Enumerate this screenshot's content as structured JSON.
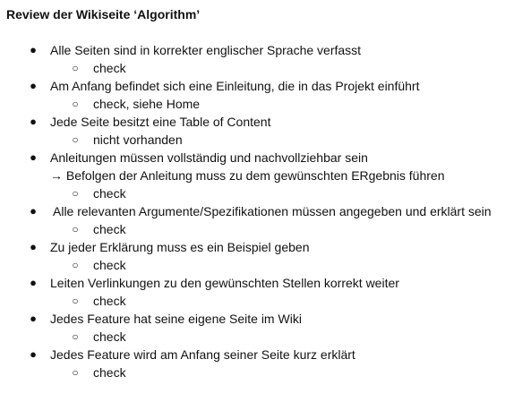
{
  "title": "Review der Wikiseite ‘Algorithm’",
  "bullet_glyph": "●",
  "sub_bullet_glyph": "○",
  "items": [
    {
      "text": "Alle Seiten sind in korrekter englischer Sprache verfasst",
      "sub": "check"
    },
    {
      "text": "Am Anfang befindet sich eine Einleitung, die in das Projekt einführt",
      "sub": "check, siehe Home"
    },
    {
      "text": "Jede Seite besitzt eine Table of Content",
      "sub": "nicht vorhanden"
    },
    {
      "text": "Anleitungen müssen vollständig und nachvollziehbar sein",
      "extra": "→ Befolgen der Anleitung muss zu dem gewünschten ERgebnis führen",
      "sub": "check"
    },
    {
      "text": "Alle relevanten Argumente/Spezifikationen müssen angegeben und erklärt sein",
      "sub": "check"
    },
    {
      "text": "Zu jeder Erklärung muss es ein Beispiel geben",
      "sub": "check"
    },
    {
      "text": "Leiten Verlinkungen zu den gewünschten Stellen korrekt weiter",
      "sub": "check"
    },
    {
      "text": "Jedes Feature hat seine eigene Seite im Wiki",
      "sub": "check"
    },
    {
      "text": "Jedes Feature wird am Anfang seiner Seite kurz erklärt",
      "sub": "check"
    }
  ]
}
